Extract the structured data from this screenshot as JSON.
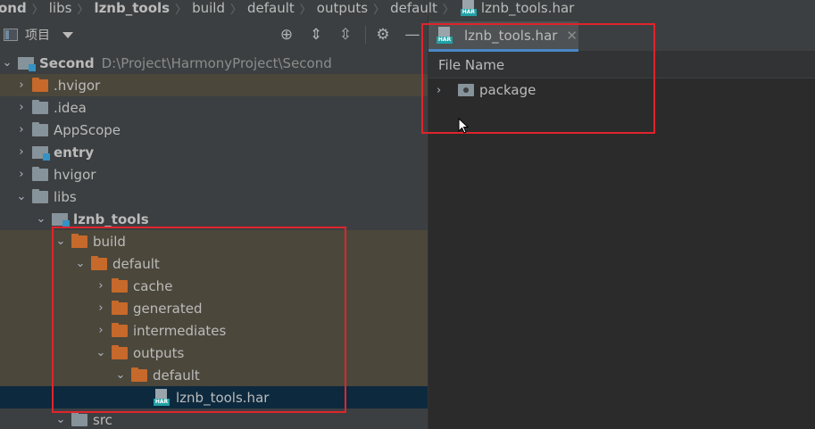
{
  "breadcrumb": [
    {
      "label": "ond",
      "bold": true
    },
    {
      "label": "libs",
      "bold": false
    },
    {
      "label": "lznb_tools",
      "bold": true
    },
    {
      "label": "build",
      "bold": false
    },
    {
      "label": "default",
      "bold": false
    },
    {
      "label": "outputs",
      "bold": false
    },
    {
      "label": "default",
      "bold": false
    },
    {
      "label": "lznb_tools.har",
      "bold": false
    }
  ],
  "project_panel": {
    "title": "项目",
    "toolbar_icons": [
      "locate-icon",
      "expand-all-icon",
      "collapse-all-icon",
      "gear-icon",
      "hide-icon"
    ]
  },
  "tree": [
    {
      "label": "Second",
      "bold": true,
      "path": "D:\\Project\\HarmonyProject\\Second",
      "expanded": true
    },
    {
      "label": ".hvigor",
      "expanded": false
    },
    {
      "label": ".idea",
      "expanded": false
    },
    {
      "label": "AppScope",
      "expanded": false
    },
    {
      "label": "entry",
      "bold": true,
      "expanded": false
    },
    {
      "label": "hvigor",
      "expanded": false
    },
    {
      "label": "libs",
      "expanded": true
    },
    {
      "label": "lznb_tools",
      "bold": true,
      "expanded": true
    },
    {
      "label": "build",
      "expanded": true
    },
    {
      "label": "default",
      "expanded": true
    },
    {
      "label": "cache",
      "expanded": false
    },
    {
      "label": "generated",
      "expanded": false
    },
    {
      "label": "intermediates",
      "expanded": false
    },
    {
      "label": "outputs",
      "expanded": true
    },
    {
      "label": "default",
      "expanded": true
    },
    {
      "label": "lznb_tools.har",
      "selected": true
    },
    {
      "label": "src",
      "expanded": true
    }
  ],
  "editor": {
    "tab_label": "lznb_tools.har",
    "har_badge": "HAR",
    "column_header": "File Name",
    "rows": [
      {
        "label": "package"
      }
    ]
  },
  "colors": {
    "highlight_box": "#e0242c",
    "folder": "#c6692b",
    "selection": "#0d293e"
  }
}
